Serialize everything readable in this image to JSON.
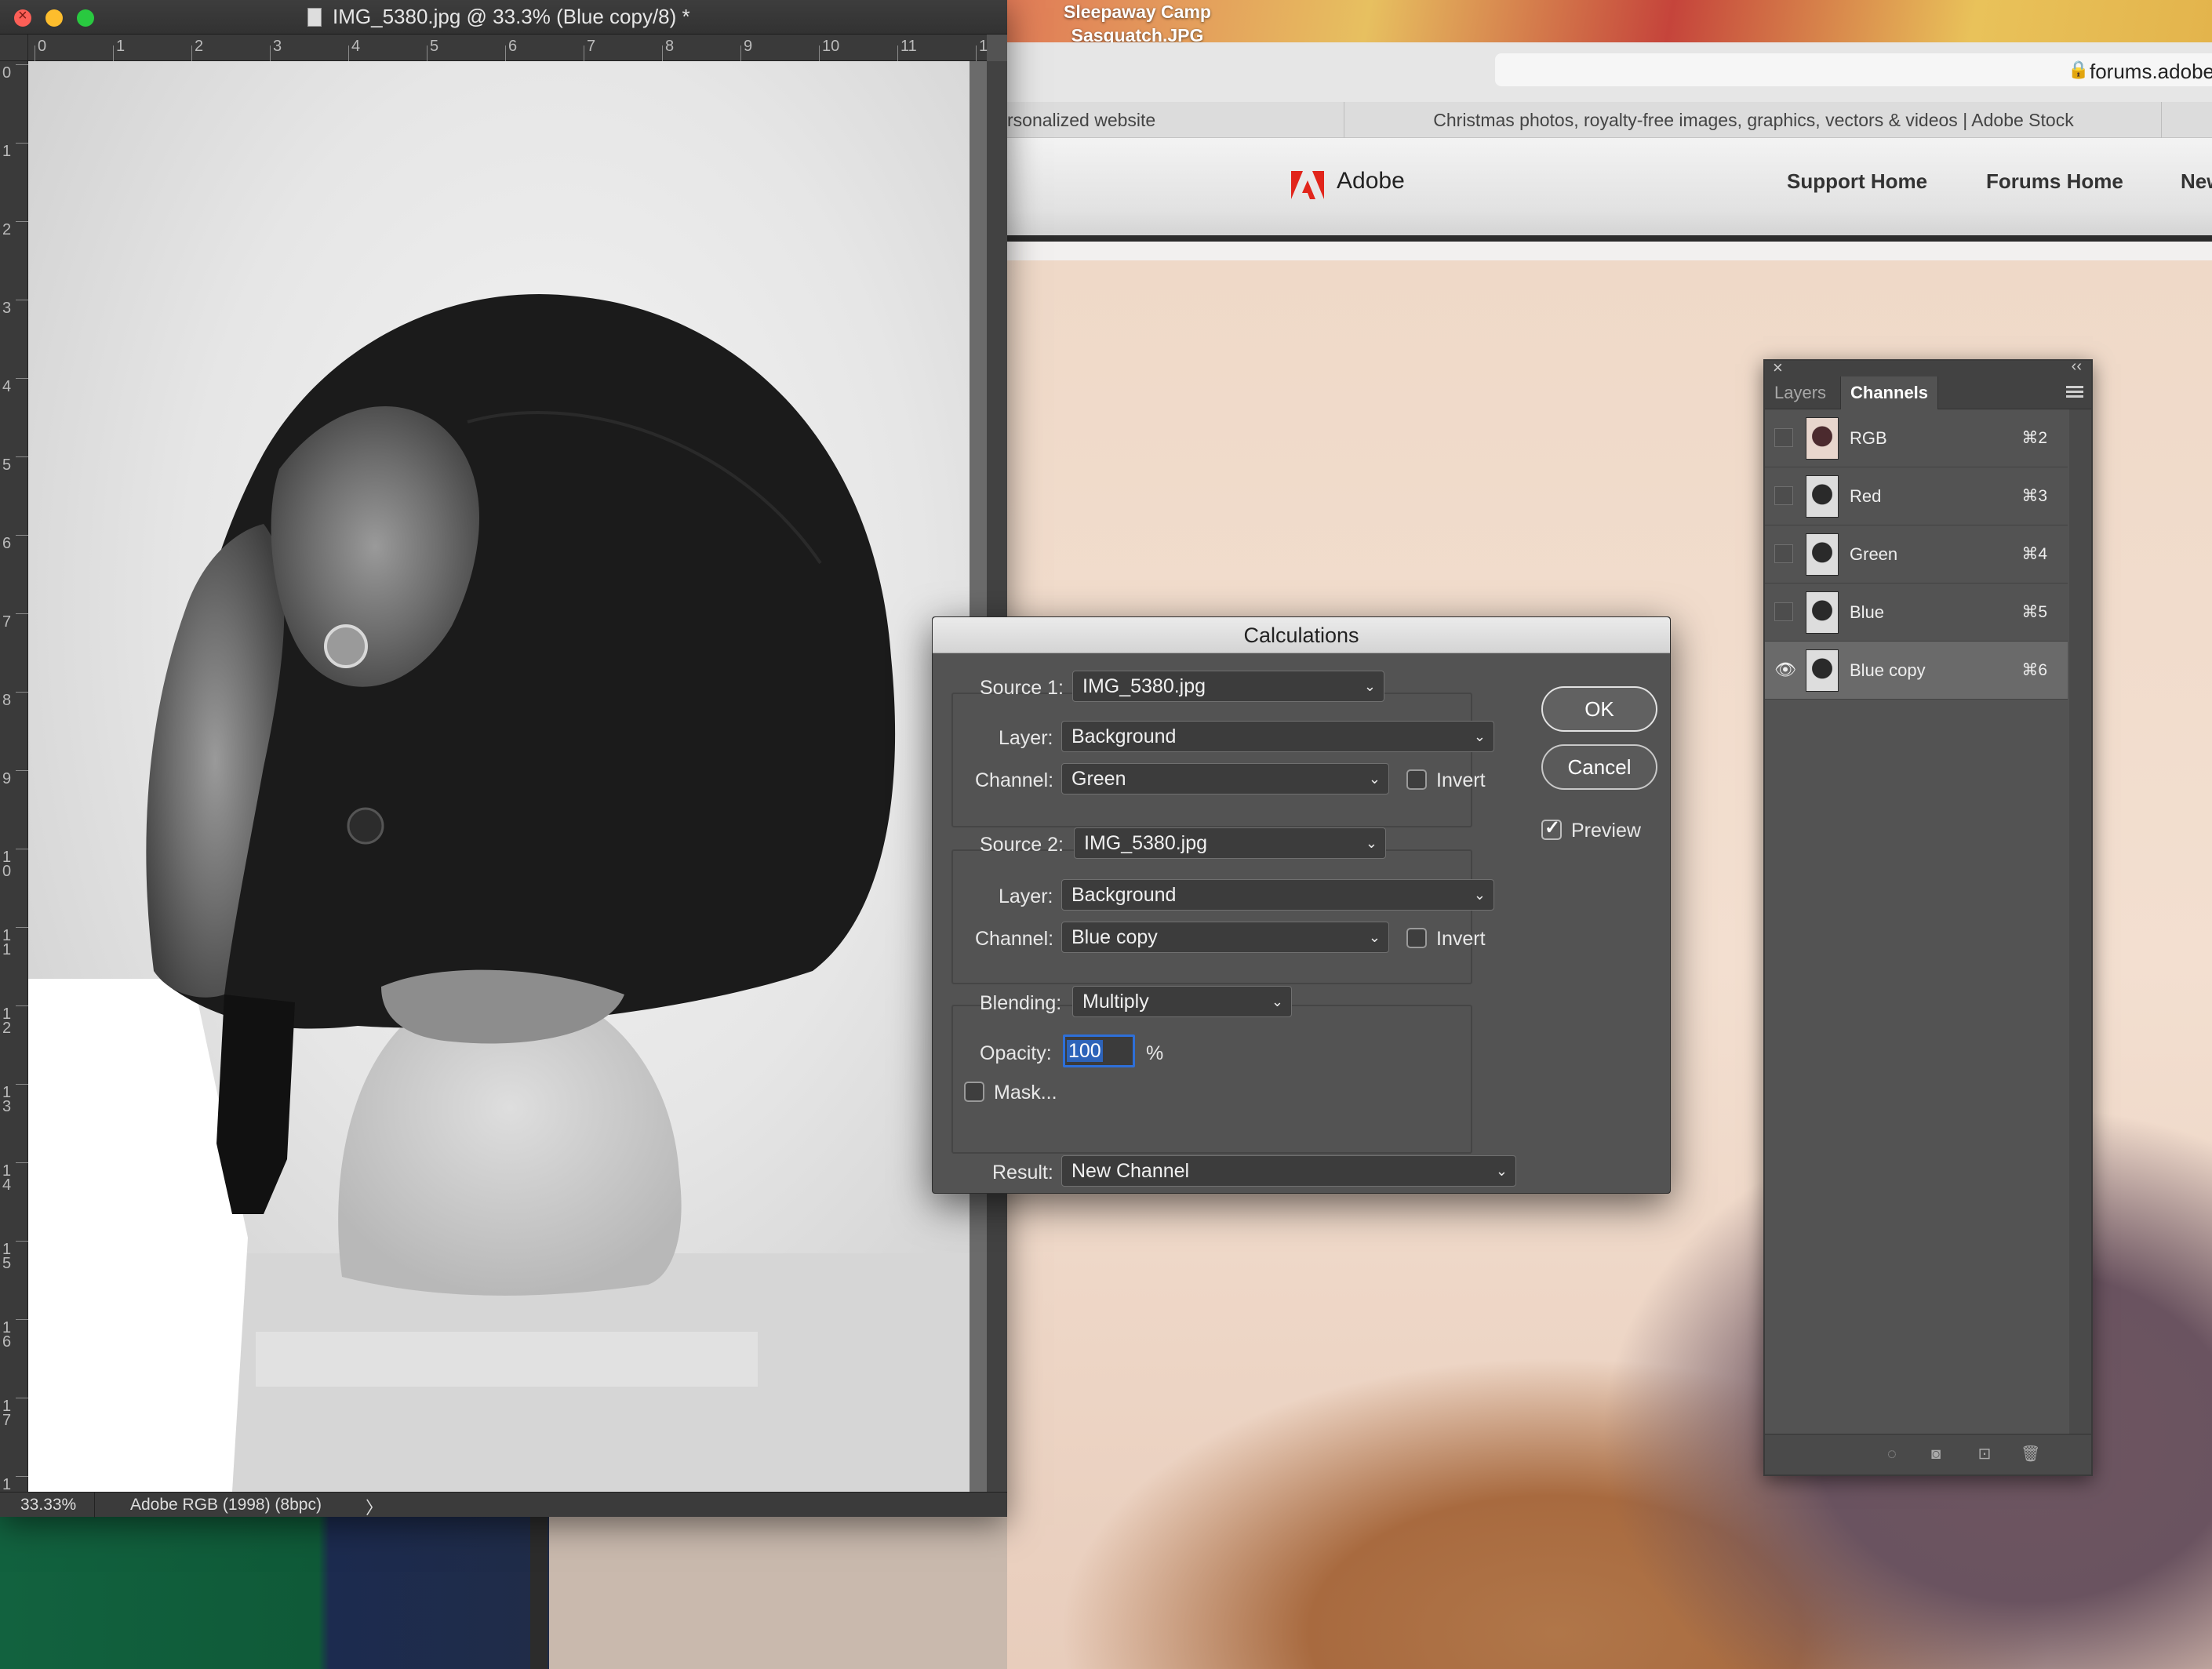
{
  "desktop": {
    "label_line1": "Sleepaway Camp",
    "label_line2": "Sasquatch.JPG"
  },
  "browser": {
    "url": "forums.adobe",
    "tabs": [
      {
        "label": "rsonalized website"
      },
      {
        "label": "Christmas photos, royalty-free images, graphics, vectors & videos | Adobe Stock"
      }
    ],
    "nav": {
      "brand": "Adobe",
      "links": [
        "Support Home",
        "Forums Home",
        "New"
      ]
    }
  },
  "ps_window": {
    "title": "IMG_5380.jpg @ 33.3% (Blue copy/8) *",
    "ruler_h": [
      "0",
      "1",
      "2",
      "3",
      "4",
      "5",
      "6",
      "7",
      "8",
      "9",
      "10",
      "11",
      "1"
    ],
    "ruler_v": [
      "0",
      "1",
      "2",
      "3",
      "4",
      "5",
      "6",
      "7",
      "8",
      "9",
      "1 0",
      "1 1",
      "1 2",
      "1 3",
      "1 4",
      "1 5",
      "1 6",
      "1 7",
      "1"
    ],
    "status": {
      "zoom": "33.33%",
      "profile": "Adobe RGB (1998) (8bpc)",
      "arrow": "〉"
    }
  },
  "channels_panel": {
    "tabs": [
      "Layers",
      "Channels"
    ],
    "active_tab": "Channels",
    "channels": [
      {
        "name": "RGB",
        "shortcut": "⌘2",
        "visible": false
      },
      {
        "name": "Red",
        "shortcut": "⌘3",
        "visible": false
      },
      {
        "name": "Green",
        "shortcut": "⌘4",
        "visible": false
      },
      {
        "name": "Blue",
        "shortcut": "⌘5",
        "visible": false
      },
      {
        "name": "Blue copy",
        "shortcut": "⌘6",
        "visible": true,
        "selected": true
      }
    ],
    "close_glyph": "×",
    "collapse_glyph": "‹‹",
    "eye_glyph": "👁"
  },
  "calculations": {
    "title": "Calculations",
    "source1": {
      "label": "Source 1:",
      "file": "IMG_5380.jpg",
      "layer_label": "Layer:",
      "layer": "Background",
      "channel_label": "Channel:",
      "channel": "Green",
      "invert_label": "Invert",
      "invert": false
    },
    "source2": {
      "label": "Source 2:",
      "file": "IMG_5380.jpg",
      "layer_label": "Layer:",
      "layer": "Background",
      "channel_label": "Channel:",
      "channel": "Blue copy",
      "invert_label": "Invert",
      "invert": false
    },
    "blending": {
      "label": "Blending:",
      "mode": "Multiply",
      "opacity_label": "Opacity:",
      "opacity": "100",
      "percent": "%",
      "mask_label": "Mask...",
      "mask": false
    },
    "result": {
      "label": "Result:",
      "value": "New Channel"
    },
    "ok_label": "OK",
    "cancel_label": "Cancel",
    "preview_label": "Preview",
    "preview": true,
    "chevron": "⌄"
  }
}
